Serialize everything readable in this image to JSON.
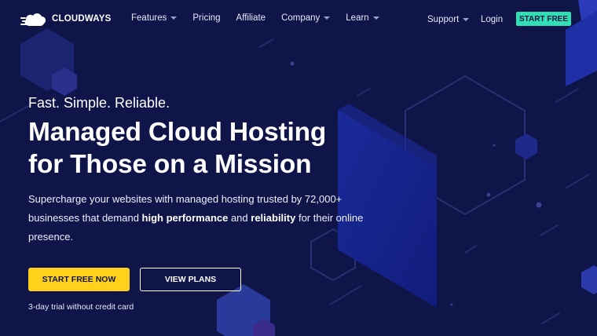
{
  "brand": {
    "name": "CLOUDWAYS"
  },
  "nav": {
    "items": [
      {
        "label": "Features",
        "dropdown": true
      },
      {
        "label": "Pricing",
        "dropdown": false
      },
      {
        "label": "Affiliate",
        "dropdown": false
      },
      {
        "label": "Company",
        "dropdown": true
      },
      {
        "label": "Learn",
        "dropdown": true
      }
    ],
    "support_label": "Support",
    "login_label": "Login",
    "start_free_label": "START FREE"
  },
  "hero": {
    "tagline": "Fast. Simple. Reliable.",
    "headline_line1": "Managed Cloud Hosting",
    "headline_line2": "for Those on a Mission",
    "description": {
      "part1": "Supercharge your websites with managed hosting trusted by 72,000+ businesses that demand ",
      "bold1": "high performance",
      "part2": " and ",
      "bold2": "reliability",
      "part3": " for their online presence."
    },
    "primary_cta": "START FREE NOW",
    "secondary_cta": "VIEW PLANS",
    "trial_note": "3-day trial without credit card"
  },
  "colors": {
    "background": "#0f1449",
    "accent_teal": "#2fe0b4",
    "accent_yellow": "#ffd11a"
  },
  "icons": {
    "logo": "cloud-logo-icon",
    "dropdown": "chevron-down-icon"
  }
}
